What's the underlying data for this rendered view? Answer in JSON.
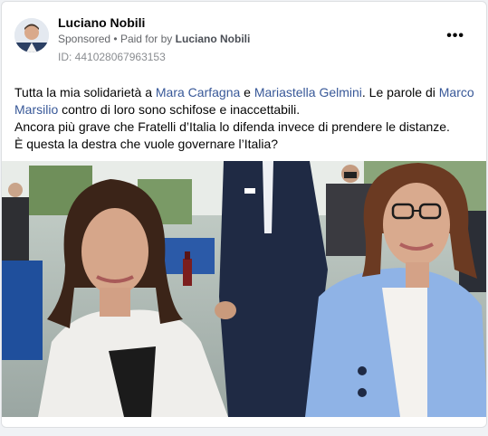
{
  "post": {
    "author": "Luciano Nobili",
    "sponsored_label": "Sponsored",
    "separator": "•",
    "paid_for_by_label": "Paid for by",
    "paid_for_by_name": "Luciano Nobili",
    "ad_id": "ID: 441028067963153",
    "more_icon": "more-options-icon"
  },
  "text": {
    "line1_prefix": "Tutta la mia solidarietà a ",
    "mention1": "Mara Carfagna",
    "conj": " e ",
    "mention2": "Mariastella Gelmini",
    "line1_mid": ". Le parole di ",
    "mention3": "Marco Marsilio",
    "line1_suffix": " contro di loro sono schifose e inaccettabili.",
    "line2": "Ancora più grave che Fratelli d’Italia lo difenda invece di prendere le distanze.",
    "line3": "È questa la destra che vuole governare l’Italia?"
  },
  "colors": {
    "link": "#385898",
    "text": "#050505",
    "meta": "#65676b"
  }
}
